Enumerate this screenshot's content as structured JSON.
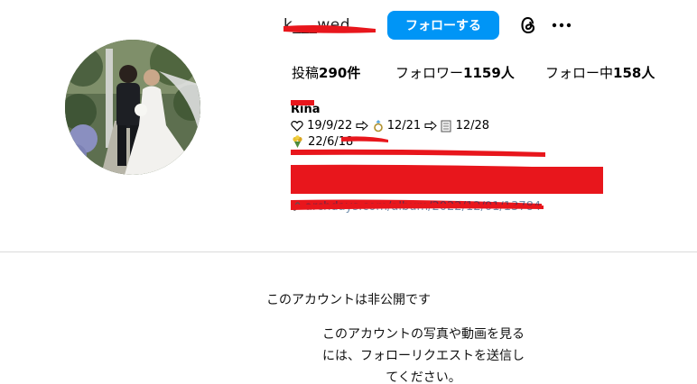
{
  "profile": {
    "username": "k___wed",
    "follow_label": "フォローする"
  },
  "stats": {
    "posts_label": "投稿",
    "posts_value": "290件",
    "followers_label": "フォロワー",
    "followers_value": "1159人",
    "following_label": "フォロー中",
    "following_value": "158人"
  },
  "bio": {
    "name": "Rina",
    "line1_a": "19/9/22",
    "line1_b": "12/21",
    "line1_c": "12/28",
    "line2": "22/6/18",
    "link": "archdays.com/album/2022/12/01/13784"
  },
  "private": {
    "title": "このアカウントは非公開です",
    "description": "このアカウントの写真や動画を見るには、フォローリクエストを送信してください。"
  },
  "colors": {
    "accent": "#0095f6",
    "redaction": "#e8161c",
    "divider": "#dbdbdb"
  },
  "icons": [
    "threads-icon",
    "more-icon",
    "heart-icon",
    "arrow-right-icon",
    "ring-icon",
    "document-icon",
    "bouquet-icon",
    "link-icon"
  ]
}
